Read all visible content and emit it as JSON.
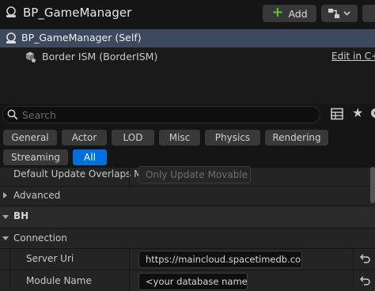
{
  "header": {
    "title": "BP_GameManager",
    "add_label": "Add",
    "icons": [
      "blueprint-object-icon",
      "plus-icon",
      "blueprint-connect-icon",
      "chevron-down-icon"
    ],
    "add_icon_color": "#5cc22f"
  },
  "components": {
    "self_label": "BP_GameManager (Self)",
    "child_label": "Border ISM (BorderISM)",
    "edit_link": "Edit in C++",
    "selected_color": "#3d4a5e"
  },
  "search": {
    "placeholder": "Search"
  },
  "filters": {
    "chips": [
      "General",
      "Actor",
      "LOD",
      "Misc",
      "Physics",
      "Rendering",
      "Streaming",
      "All"
    ],
    "active": "All",
    "active_color": "#0070e0"
  },
  "details": {
    "overlaps_label": "Default Update Overlaps M...",
    "overlaps_value": "Only Update Movable",
    "advanced_label": "Advanced",
    "bh_label": "BH",
    "connection_label": "Connection",
    "server_uri_label": "Server Uri",
    "server_uri_value": "https://maincloud.spacetimedb.com",
    "module_name_label": "Module Name",
    "module_name_value": "<your database name>"
  }
}
